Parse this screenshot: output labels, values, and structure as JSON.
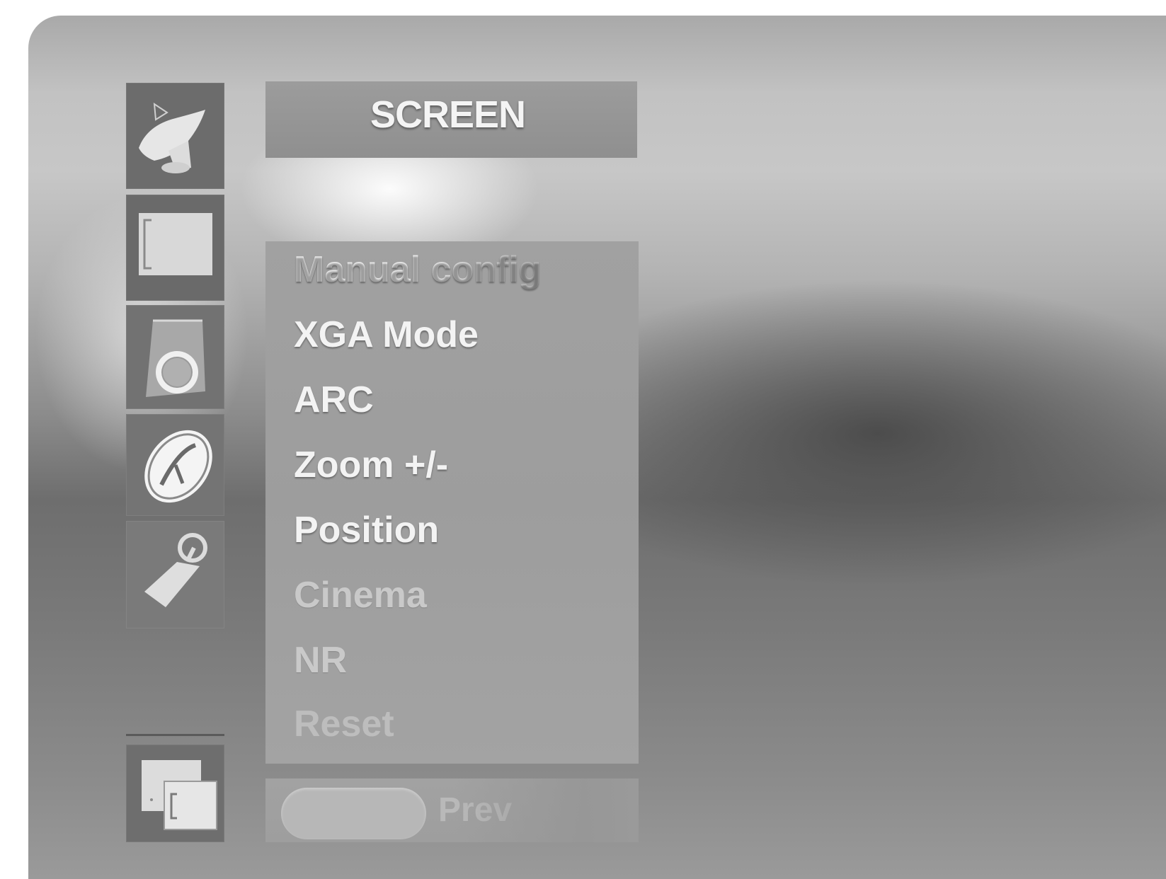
{
  "menu": {
    "title": "SCREEN",
    "items": [
      {
        "label": "Manual config"
      },
      {
        "label": "XGA Mode"
      },
      {
        "label": "ARC"
      },
      {
        "label": "Zoom +/-"
      },
      {
        "label": "Position"
      },
      {
        "label": "Cinema"
      },
      {
        "label": "NR"
      },
      {
        "label": "Reset"
      }
    ],
    "bottom_bar": {
      "label": "Prev"
    }
  },
  "sidebar_icons": [
    {
      "icon": "satellite-dish-icon"
    },
    {
      "icon": "screen-icon"
    },
    {
      "icon": "speaker-icon"
    },
    {
      "icon": "clock-icon"
    },
    {
      "icon": "wrench-icon"
    },
    {
      "icon": "pip-windows-icon"
    }
  ],
  "colors": {
    "panel": "#9f9f9f",
    "text": "#f3f3f3",
    "tile": "#707070"
  }
}
